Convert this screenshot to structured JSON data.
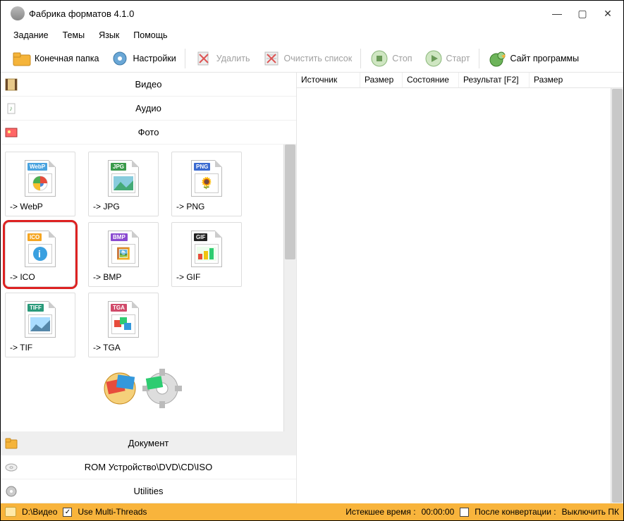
{
  "window": {
    "title": "Фабрика форматов 4.1.0"
  },
  "menu": {
    "task": "Задание",
    "themes": "Темы",
    "language": "Язык",
    "help": "Помощь"
  },
  "toolbar": {
    "output_folder": "Конечная папка",
    "settings": "Настройки",
    "delete": "Удалить",
    "clear_list": "Очистить список",
    "stop": "Стоп",
    "start": "Старт",
    "site": "Сайт программы"
  },
  "categories": {
    "video": "Видео",
    "audio": "Аудио",
    "photo": "Фото",
    "document": "Документ",
    "rom": "ROM Устройство\\DVD\\CD\\ISO",
    "utilities": "Utilities"
  },
  "formats": {
    "webp": "-> WebP",
    "jpg": "-> JPG",
    "png": "-> PNG",
    "ico": "-> ICO",
    "bmp": "-> BMP",
    "gif": "-> GIF",
    "tif": "-> TIF",
    "tga": "-> TGA"
  },
  "columns": {
    "source": "Источник",
    "size": "Размер",
    "state": "Состояние",
    "result": "Результат [F2]",
    "size2": "Размер"
  },
  "status": {
    "path": "D:\\Видео",
    "multithreads": "Use Multi-Threads",
    "elapsed_label": "Истекшее время :",
    "elapsed_value": "00:00:00",
    "after_label": "После конвертации :",
    "after_value": "Выключить ПК"
  }
}
